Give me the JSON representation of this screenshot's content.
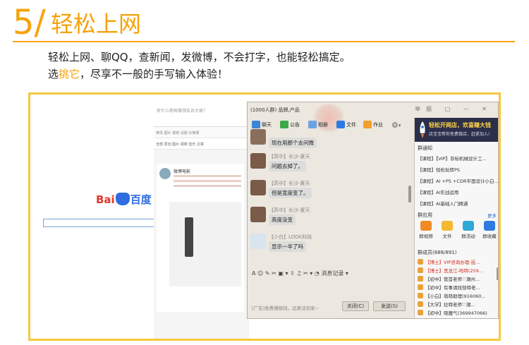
{
  "header": {
    "number": "5/",
    "title": "轻松上网",
    "line1": "轻松上网、聊QQ，查新闻，发微博，不会打字，也能轻松搞定。",
    "line2_pre": "选",
    "line2_highlight": "挑它",
    "line2_post": "，尽享不一般的手写输入体验！"
  },
  "baidu": {
    "logo_bai": "Bai",
    "logo_du": "百度"
  },
  "weibo": {
    "question": "有什么新鲜事想告诉大家？",
    "tools": "表情  图片  视频  话题  长微博",
    "tabs": "全部  原创  图片  视频  音乐  文章",
    "post_name": "微博电影"
  },
  "qq": {
    "title": "(1000人群) 品牌,产品",
    "window_btns": "举报 □ — ✕",
    "toolbar": [
      "聊天",
      "公告",
      "相册",
      "文件",
      "作业"
    ],
    "messages": [
      {
        "sender": "",
        "text": "现在用那个去问微"
      },
      {
        "sender": "【高中】长沙-夏天",
        "text": "问题去掉了。"
      },
      {
        "sender": "【高中】长沙-夏天",
        "text": "但是宽度变了。"
      },
      {
        "sender": "【高中】长沙-夏天",
        "text": "高度没变"
      },
      {
        "sender": "【小白】LOOK科技",
        "text": "显示一半了吗"
      }
    ],
    "input_tools": "A ☺ ✎ ✂ ▣ ▾ ⇪ ♫ ✂ ▾ ◔ 消息记录 ▾",
    "input_hint": "[广告]免费赚额钱，远离话到家~",
    "close_label": "关闭(C)",
    "send_label": "发送(S)",
    "ad": {
      "line1": "轻松开网店，欢喜赚大钱",
      "line2": "店宝宝帮你免费做店，赶紧加入!"
    },
    "notice_title": "群通知",
    "notices": [
      "【课程】【VIP】非标机械设计工...",
      "【课程】轻松玩转PS",
      "【课程】AI +PS +CDR平面设计小白...",
      "【课程】AI实战运用",
      "【课程】AI基础入门精通"
    ],
    "apps_title": "群应用",
    "apps_more": "更多",
    "apps": [
      "群视频",
      "文件",
      "群活动",
      "群收藏"
    ],
    "members_title": "群成员(688/891)",
    "members": [
      {
        "label": "【博士】VIP咨询办理-昆...",
        "red": true
      },
      {
        "label": "【博士】黑龙江-哈特(259...",
        "red": true
      },
      {
        "label": "【初中】管首老师♡潮州...",
        "red": false
      },
      {
        "label": "【初中】有事请找彗特老...",
        "red": false
      },
      {
        "label": "【小白】萌萌助理(916060...",
        "red": false
      },
      {
        "label": "【大学】拉特老师♡潮...",
        "red": false
      },
      {
        "label": "【初中】晓魔气(369947066)",
        "red": false
      }
    ]
  },
  "colors": {
    "accent": "#f5a20a",
    "frame": "#f5c842"
  }
}
